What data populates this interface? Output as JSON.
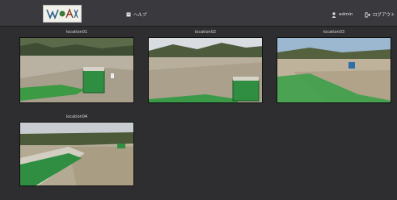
{
  "header": {
    "help_label": "ヘルプ",
    "user_label": "admin",
    "logout_label": "ログアウト"
  },
  "cameras": [
    {
      "name": "location01"
    },
    {
      "name": "location02"
    },
    {
      "name": "location03"
    },
    {
      "name": "location04"
    }
  ]
}
